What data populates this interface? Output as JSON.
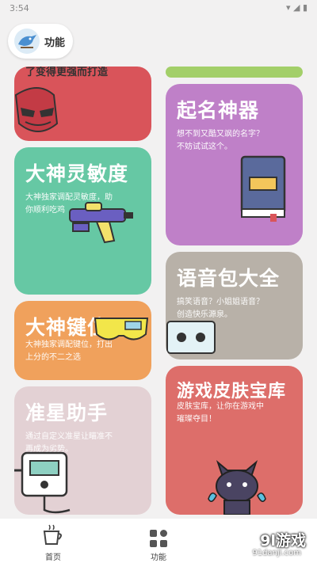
{
  "status_bar": {
    "time": "3:54"
  },
  "header": {
    "title": "功能"
  },
  "cards": [
    {
      "id": "top-left-partial",
      "desc": "了变得更强而打造",
      "color": "#d9545a"
    },
    {
      "id": "top-right-partial",
      "color": "#a3cf69"
    },
    {
      "id": "naming",
      "title": "起名神器",
      "desc": "想不到又酷又飒的名字？\n不妨试试这个。",
      "color": "#bf80c8"
    },
    {
      "id": "sensitivity",
      "title": "大神灵敏度",
      "desc": "大神独家调配灵敏度，助\n你顺利吃鸡",
      "color": "#66c8a4"
    },
    {
      "id": "voice-pack",
      "title": "语音包大全",
      "desc": "搞笑语音？小姐姐语音？\n创造快乐源泉。",
      "color": "#b8b1a8"
    },
    {
      "id": "keymap",
      "title": "大神键位",
      "desc": "大神独家调配键位，打出\n上分的不二之选",
      "color": "#f0a15c"
    },
    {
      "id": "skins",
      "title": "游戏皮肤宝库",
      "desc": "皮肤宝库，让你在游戏中\n璀璨夺目！",
      "color": "#dd6e6a"
    },
    {
      "id": "crosshair",
      "title": "准星助手",
      "desc": "通过自定义准星让瞄准不\n再成为劣势。",
      "color": "#e3d1d4"
    }
  ],
  "bottom_nav": [
    {
      "label": "首页",
      "icon": "coffee-cup-icon",
      "active": false
    },
    {
      "label": "功能",
      "icon": "grid-icon",
      "active": true
    }
  ],
  "watermark": {
    "brand": "9l游戏",
    "url": "91danji.com"
  }
}
